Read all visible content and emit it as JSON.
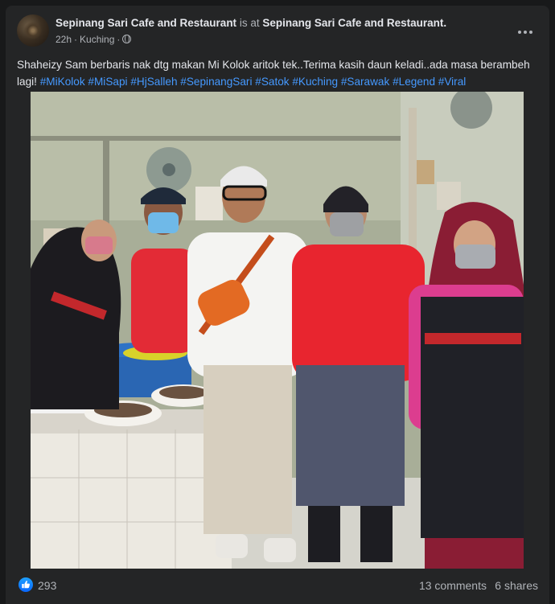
{
  "post": {
    "author": "Sepinang Sari Cafe and Restaurant",
    "checkin_text": "is at",
    "location": "Sepinang Sari Cafe and Restaurant.",
    "time": "22h",
    "place": "Kuching",
    "caption_text": "Shaheizy Sam berbaris nak dtg makan Mi Kolok aritok tek..Terima kasih daun keladi..ada masa berambeh lagi!",
    "hashtags": [
      "#MiKolok",
      "#MiSapi",
      "#HjSalleh",
      "#SepinangSari",
      "#Satok",
      "#Kuching",
      "#Sarawak",
      "#Legend",
      "#Viral"
    ]
  },
  "reactions": {
    "count": "293"
  },
  "stats": {
    "comments": "13 comments",
    "shares": "6 shares"
  },
  "icons": {
    "more": "more-horizontal-icon",
    "privacy": "globe-icon",
    "reaction": "like-thumb-icon"
  },
  "colors": {
    "background": "#18191a",
    "card": "#242526",
    "link": "#4599ff",
    "like": "#0866ff"
  }
}
